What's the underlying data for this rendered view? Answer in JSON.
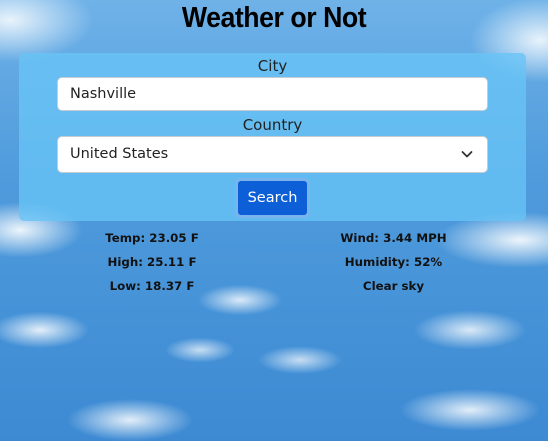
{
  "app": {
    "title": "Weather or Not"
  },
  "form": {
    "city_label": "City",
    "city_value": "Nashville",
    "country_label": "Country",
    "country_selected": "United States",
    "search_label": "Search"
  },
  "weather": {
    "temp": "Temp: 23.05 F",
    "high": "High: 25.11 F",
    "low": "Low: 18.37 F",
    "wind": "Wind: 3.44 MPH",
    "humidity": "Humidity: 52%",
    "description": "Clear sky"
  },
  "colors": {
    "card_background": "#68c4f6",
    "search_button": "#0c5fd6"
  },
  "icons": {
    "country_dropdown": "chevron-down-icon"
  }
}
